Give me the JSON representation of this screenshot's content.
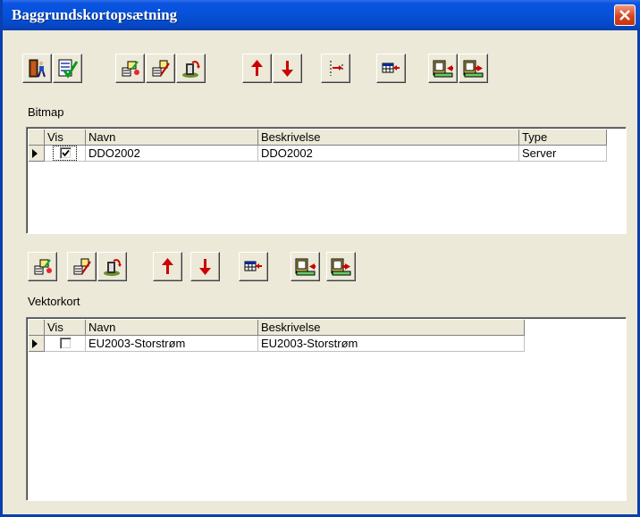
{
  "window": {
    "title": "Baggrundskortopsætning"
  },
  "bitmap": {
    "label": "Bitmap",
    "columns": [
      "Vis",
      "Navn",
      "Beskrivelse",
      "Type"
    ],
    "rows": [
      {
        "vis": true,
        "navn": "DDO2002",
        "beskrivelse": "DDO2002",
        "type": "Server"
      }
    ]
  },
  "vektor": {
    "label": "Vektorkort",
    "columns": [
      "Vis",
      "Navn",
      "Beskrivelse"
    ],
    "rows": [
      {
        "vis": false,
        "navn": "EU2003-Storstrøm",
        "beskrivelse": "EU2003-Storstrøm"
      }
    ]
  },
  "icons": {
    "top_toolbar": [
      "exit-door-icon",
      "checklist-approve-icon",
      "add-layer-icon",
      "edit-layer-icon",
      "undo-layer-icon",
      "move-up-arrow-icon",
      "move-down-arrow-icon",
      "split-insert-icon",
      "table-insert-icon",
      "import-icon",
      "export-icon"
    ],
    "vector_toolbar": [
      "add-layer-icon",
      "edit-layer-icon",
      "undo-layer-icon",
      "move-up-arrow-icon",
      "move-down-arrow-icon",
      "table-insert-icon",
      "import-icon",
      "export-icon"
    ]
  }
}
